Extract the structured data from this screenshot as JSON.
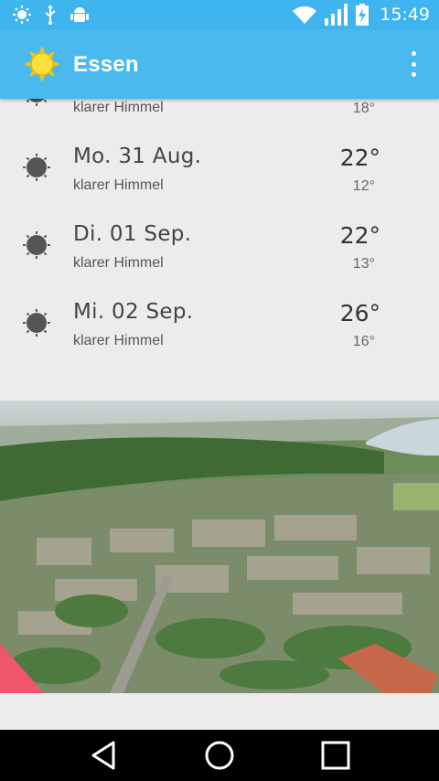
{
  "status_bar": {
    "time": "15:49",
    "icons": [
      "brightness-icon",
      "usb-icon",
      "android-debug-icon",
      "wifi-icon",
      "signal-icon",
      "battery-charging-icon"
    ]
  },
  "app_bar": {
    "title": "Essen",
    "logo_icon": "sun-logo-icon",
    "menu_icon": "overflow-menu-icon"
  },
  "forecast": {
    "partial_row": {
      "condition": "klarer Himmel",
      "low": "18°"
    },
    "days": [
      {
        "day": "Mo. 31 Aug.",
        "condition": "klarer Himmel",
        "high": "22°",
        "low": "12°",
        "icon": "clear-sky-icon"
      },
      {
        "day": "Di. 01 Sep.",
        "condition": "klarer Himmel",
        "high": "22°",
        "low": "13°",
        "icon": "clear-sky-icon"
      },
      {
        "day": "Mi. 02 Sep.",
        "condition": "klarer Himmel",
        "high": "26°",
        "low": "16°",
        "icon": "clear-sky-icon"
      }
    ]
  },
  "photo": {
    "subject": "aerial-city-photo"
  },
  "nav_bar": {
    "icons": [
      "back-icon",
      "home-icon",
      "recents-icon"
    ]
  },
  "colors": {
    "accent": "#4ab9ee",
    "status_bar": "#3eb5ee",
    "background": "#ececec",
    "nav_bar": "#000000"
  }
}
